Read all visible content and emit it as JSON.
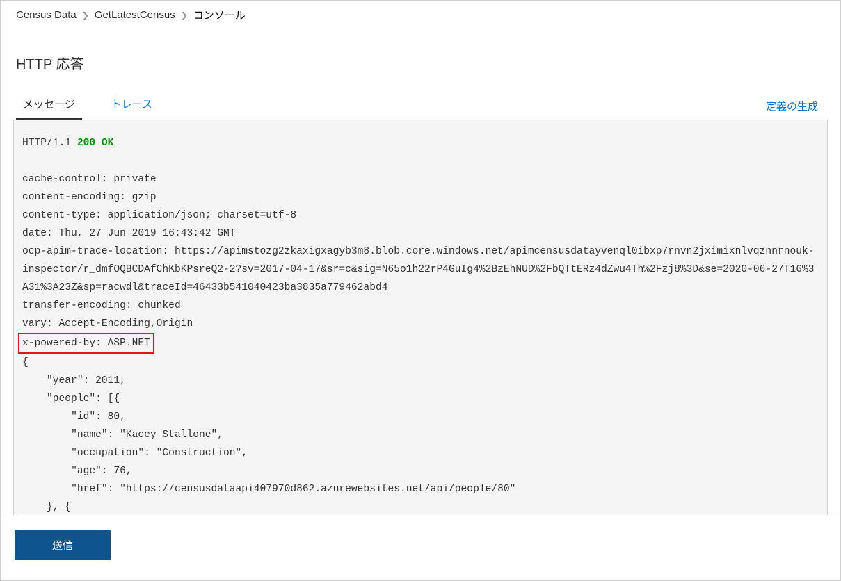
{
  "breadcrumb": {
    "items": [
      "Census Data",
      "GetLatestCensus",
      "コンソール"
    ]
  },
  "page": {
    "title": "HTTP 応答"
  },
  "tabs": {
    "message": "メッセージ",
    "trace": "トレース"
  },
  "actions": {
    "generate_definition": "定義の生成",
    "send": "送信"
  },
  "response": {
    "protocol": "HTTP/1.1",
    "status": "200 OK",
    "headers": {
      "cache_control": "cache-control: private",
      "content_encoding": "content-encoding: gzip",
      "content_type": "content-type: application/json; charset=utf-8",
      "date": "date: Thu, 27 Jun 2019 16:43:42 GMT",
      "ocp_apim_trace_location": "ocp-apim-trace-location: https://apimstozg2zkaxigxagyb3m8.blob.core.windows.net/apimcensusdatayvenql0ibxp7rnvn2jximixnlvqznnrnouk-inspector/r_dmfOQBCDAfChKbKPsreQ2-2?sv=2017-04-17&sr=c&sig=N65o1h22rP4GuIg4%2BzEhNUD%2FbQTtERz4dZwu4Th%2Fzj8%3D&se=2020-06-27T16%3A31%3A23Z&sp=racwdl&traceId=46433b541040423ba3835a779462abd4",
      "transfer_encoding": "transfer-encoding: chunked",
      "vary": "vary: Accept-Encoding,Origin",
      "x_powered_by": "x-powered-by: ASP.NET"
    },
    "body_lines": {
      "l0": "{",
      "l1": "    \"year\": 2011,",
      "l2": "    \"people\": [{",
      "l3": "        \"id\": 80,",
      "l4": "        \"name\": \"Kacey Stallone\",",
      "l5": "        \"occupation\": \"Construction\",",
      "l6": "        \"age\": 76,",
      "l7": "        \"href\": \"https://censusdataapi407970d862.azurewebsites.net/api/people/80\"",
      "l8": "    }, {"
    }
  }
}
